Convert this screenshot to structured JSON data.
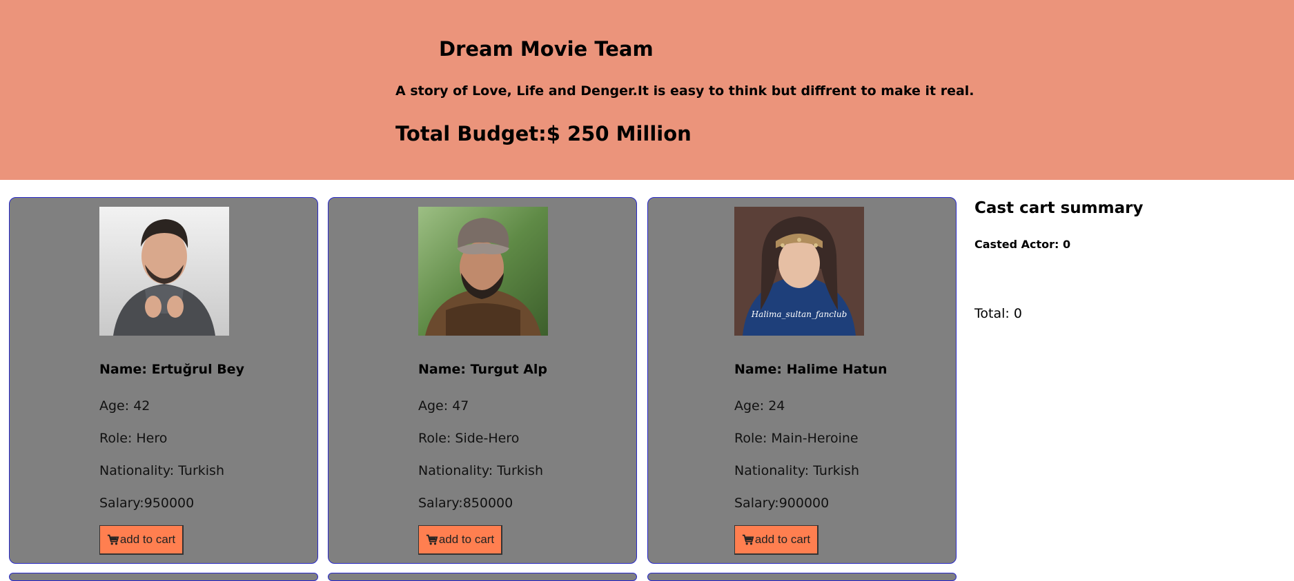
{
  "header": {
    "title": "Dream Movie Team",
    "tagline": "A story of Love, Life and Denger.It is easy to think but diffrent to make it real.",
    "budget": "Total Budget:$ 250 Million"
  },
  "actors": [
    {
      "name": "Name: Ertuğrul Bey",
      "age": "Age: 42",
      "role": "Role: Hero",
      "nationality": "Nationality: Turkish",
      "salary": "Salary:950000",
      "button_label": "add to cart",
      "photo_icon": "actor-photo"
    },
    {
      "name": "Name: Turgut Alp",
      "age": "Age: 47",
      "role": "Role: Side-Hero",
      "nationality": "Nationality: Turkish",
      "salary": "Salary:850000",
      "button_label": "add to cart",
      "photo_icon": "actor-photo"
    },
    {
      "name": "Name: Halime Hatun",
      "age": "Age: 24",
      "role": "Role: Main-Heroine",
      "nationality": "Nationality: Turkish",
      "salary": "Salary:900000",
      "button_label": "add to cart",
      "photo_icon": "actor-photo",
      "photo_caption": "Halima_sultan_fanclub"
    }
  ],
  "cart": {
    "title": "Cast cart summary",
    "casted": "Casted Actor: 0",
    "total": "Total: 0"
  },
  "colors": {
    "banner": "#eb947b",
    "card": "#808080",
    "card_border": "#2828c8",
    "button": "#ff7f50"
  }
}
